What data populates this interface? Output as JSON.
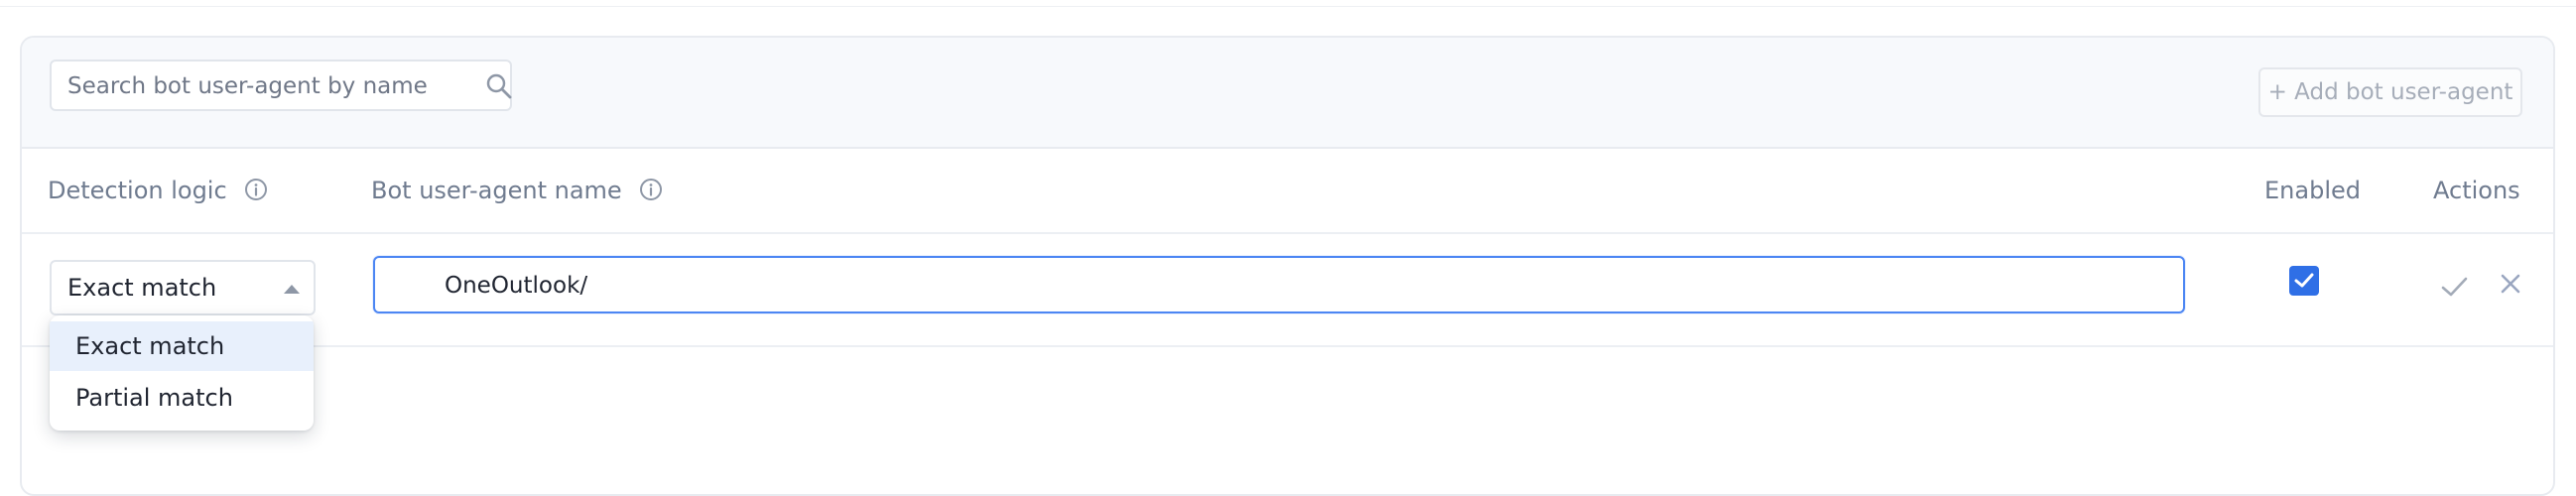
{
  "search": {
    "placeholder": "Search bot user-agent by name"
  },
  "toolbar": {
    "add_label": "+ Add bot user-agent"
  },
  "table": {
    "headers": {
      "detection_logic": "Detection logic",
      "bot_name": "Bot user-agent name",
      "enabled": "Enabled",
      "actions": "Actions"
    },
    "editing_row": {
      "detection_logic": "Exact match",
      "bot_name": "OneOutlook/",
      "enabled": true
    }
  },
  "dropdown": {
    "options": [
      "Exact match",
      "Partial match"
    ],
    "highlighted": "Exact match"
  },
  "icons": {
    "search": "search-icon",
    "info": "info-icon",
    "confirm": "check-icon",
    "cancel": "close-icon",
    "caret": "caret-up-icon"
  },
  "colors": {
    "accent": "#2f6fe6",
    "focus_border": "#4c86f3",
    "highlight": "#e8f0fc",
    "muted_text": "#6f7b8f"
  }
}
